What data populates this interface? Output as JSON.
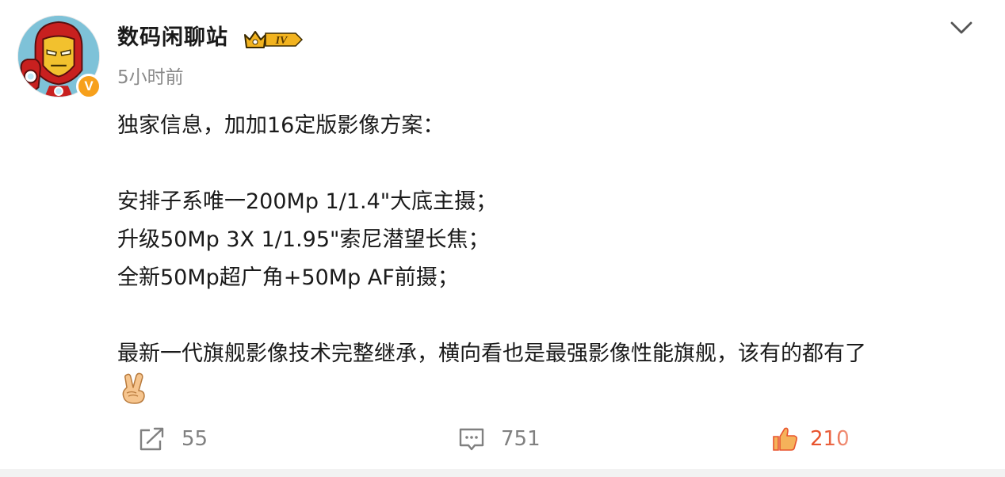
{
  "user": {
    "name": "数码闲聊站",
    "level": "IV",
    "verified_mark": "V",
    "timestamp": "5小时前"
  },
  "post": {
    "lines": [
      "独家信息，加加16定版影像方案：",
      "",
      "安排子系唯一200Mp 1/1.4\"大底主摄；",
      "升级50Mp 3X 1/1.95\"索尼潜望长焦；",
      "全新50Mp超广角+50Mp AF前摄；",
      "",
      "最新一代旗舰影像技术完整继承，横向看也是最强影像性能旗舰，该有的都有了"
    ],
    "emoji": "victory-hand"
  },
  "actions": {
    "repost": {
      "icon": "repost-icon",
      "count": "55"
    },
    "comment": {
      "icon": "comment-icon",
      "count": "751"
    },
    "like": {
      "icon": "thumbs-up-icon",
      "count": "210"
    }
  },
  "colors": {
    "username": "#1a1a1a",
    "timestamp": "#8a8a8a",
    "action_text": "#808080",
    "like_accent": "#e8542e",
    "badge_gold": "#f2b31f",
    "verified_orange": "#f7a01b"
  }
}
